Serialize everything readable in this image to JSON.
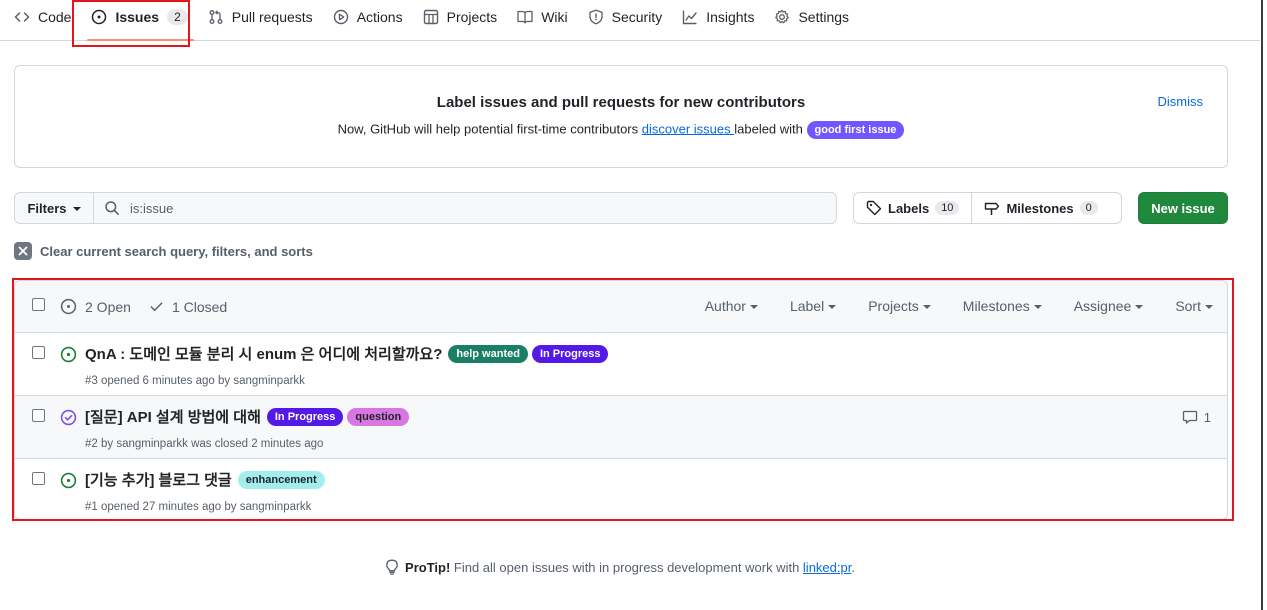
{
  "nav": {
    "code": "Code",
    "issues": "Issues",
    "issues_count": "2",
    "pull_requests": "Pull requests",
    "actions": "Actions",
    "projects": "Projects",
    "wiki": "Wiki",
    "security": "Security",
    "insights": "Insights",
    "settings": "Settings"
  },
  "banner": {
    "title": "Label issues and pull requests for new contributors",
    "desc_before": "Now, GitHub will help potential first-time contributors ",
    "desc_link": "discover issues ",
    "desc_after": "labeled with ",
    "label": "good first issue",
    "label_color": "#7057ff",
    "dismiss": "Dismiss"
  },
  "toolbar": {
    "filters": "Filters",
    "search_value": "is:issue",
    "labels": "Labels",
    "labels_count": "10",
    "milestones": "Milestones",
    "milestones_count": "0",
    "new_issue": "New issue",
    "clear": "Clear current search query, filters, and sorts"
  },
  "list_header": {
    "open": "2 Open",
    "closed": "1 Closed",
    "author": "Author",
    "label": "Label",
    "projects": "Projects",
    "milestones": "Milestones",
    "assignee": "Assignee",
    "sort": "Sort"
  },
  "issues": [
    {
      "title": "QnA : 도메인 모듈 분리 시 enum 은 어디에 처리할까요?",
      "labels": [
        {
          "name": "help wanted",
          "bg": "#1a7f64",
          "fg": "#ffffff"
        },
        {
          "name": "In Progress",
          "bg": "#5319e7",
          "fg": "#ffffff"
        }
      ],
      "meta": "#3 opened 6 minutes ago by sangminparkk",
      "state": "open",
      "comments": ""
    },
    {
      "title": "[질문] API 설계 방법에 대해",
      "labels": [
        {
          "name": "In Progress",
          "bg": "#5319e7",
          "fg": "#ffffff"
        },
        {
          "name": "question",
          "bg": "#d876e3",
          "fg": "#1f2328"
        }
      ],
      "meta": "#2 by sangminparkk was closed 2 minutes ago",
      "state": "closed",
      "comments": "1"
    },
    {
      "title": "[기능 추가] 블로그 댓글",
      "labels": [
        {
          "name": "enhancement",
          "bg": "#a2eeef",
          "fg": "#1f2328"
        }
      ],
      "meta": "#1 opened 27 minutes ago by sangminparkk",
      "state": "open",
      "comments": ""
    }
  ],
  "protip": {
    "lead": "ProTip!",
    "text": " Find all open issues with in progress development work with ",
    "link": "linked:pr",
    "end": "."
  },
  "colors": {
    "open": "#1a7f37",
    "closed": "#8250df",
    "highlight": "#e5161b"
  }
}
